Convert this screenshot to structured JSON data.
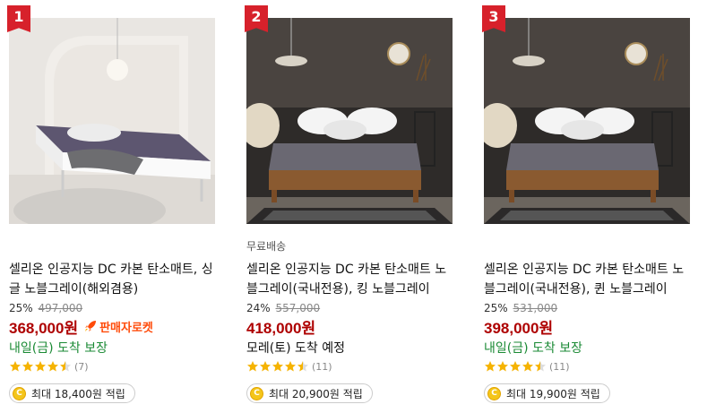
{
  "products": [
    {
      "rank": "1",
      "shipping_label": "",
      "title": "셀리온 인공지능 DC 카본 탄소매트, 싱글 노블그레이(해외겸용)",
      "discount": "25%",
      "original_price": "497,000",
      "price": "368,000원",
      "badge_label": "판매자로켓",
      "delivery": "내일(금) 도착 보장",
      "rating": 4.5,
      "review_count": "(7)",
      "reward": "최대 18,400원 적립"
    },
    {
      "rank": "2",
      "shipping_label": "무료배송",
      "title": "셀리온 인공지능 DC 카본 탄소매트 노블그레이(국내전용), 킹 노블그레이",
      "discount": "24%",
      "original_price": "557,000",
      "price": "418,000원",
      "badge_label": "",
      "delivery": "모레(토) 도착 예정",
      "rating": 4.5,
      "review_count": "(11)",
      "reward": "최대 20,900원 적립"
    },
    {
      "rank": "3",
      "shipping_label": "",
      "title": "셀리온 인공지능 DC 카본 탄소매트 노블그레이(국내전용), 퀸 노블그레이",
      "discount": "25%",
      "original_price": "531,000",
      "price": "398,000원",
      "badge_label": "",
      "delivery": "내일(금) 도착 보장",
      "rating": 4.5,
      "review_count": "(11)",
      "reward": "최대 19,900원 적립"
    }
  ],
  "colors": {
    "rank_badge": "#d7212b",
    "price": "#ae0000",
    "guaranteed_delivery": "#1a8a34",
    "rocket_badge": "#ff4b0a",
    "star": "#f5b301"
  }
}
